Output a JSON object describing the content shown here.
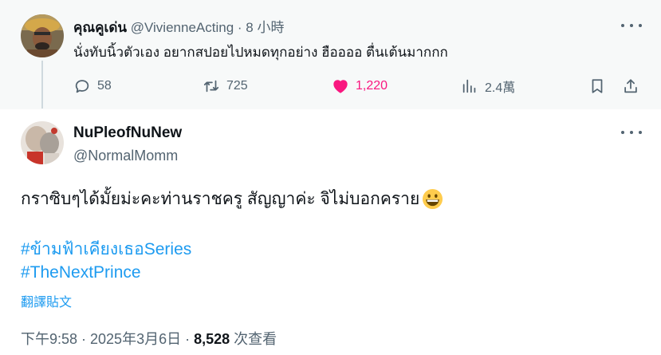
{
  "parent_tweet": {
    "display_name": "คุณคูเด่น",
    "handle": "@VivienneActing",
    "dot": "·",
    "time": "8 小時",
    "text": "นั่งทับนิ้วตัวเอง อยากสปอยไปหมดทุกอย่าง ฮืออออ ตื่นเต้นมากกก",
    "replies": "58",
    "retweets": "725",
    "likes": "1,220",
    "views": "2.4萬",
    "like_color": "#f91880",
    "icons": [
      "reply-icon",
      "retweet-icon",
      "heart-icon",
      "views-icon",
      "bookmark-icon",
      "share-icon",
      "more-icon"
    ]
  },
  "main_tweet": {
    "display_name": "NuPleofNuNew",
    "handle": "@NormalMomm",
    "text": "กราซิบๆได้มั้ยม่ะคะท่านราชครู สัญญาค่ะ จิไม่บอกคราย",
    "emoji": "grinning-face-emoji",
    "hashtags": [
      "#ข้ามฟ้าเคียงเธอSeries",
      "#TheNextPrince"
    ],
    "translate_label": "翻譯貼文",
    "timestamp": "下午9:58 · 2025年3月6日 · ",
    "view_count": "8,528",
    "view_suffix": " 次查看",
    "link_color": "#1d9bf0"
  }
}
